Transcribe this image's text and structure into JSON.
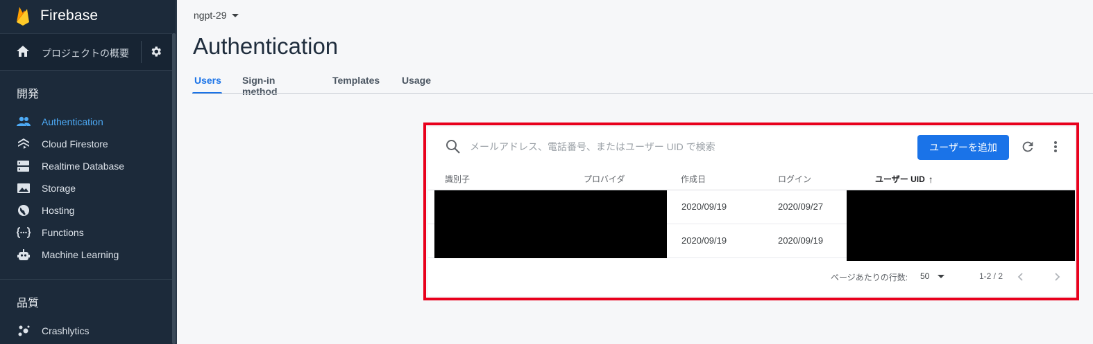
{
  "brand": {
    "name": "Firebase"
  },
  "sidebar": {
    "overview_label": "プロジェクトの概要",
    "section_dev": "開発",
    "section_quality": "品質",
    "items": [
      {
        "label": "Authentication",
        "icon": "people-icon",
        "active": true
      },
      {
        "label": "Cloud Firestore",
        "icon": "firestore-icon"
      },
      {
        "label": "Realtime Database",
        "icon": "database-icon"
      },
      {
        "label": "Storage",
        "icon": "image-icon"
      },
      {
        "label": "Hosting",
        "icon": "globe-icon"
      },
      {
        "label": "Functions",
        "icon": "functions-icon"
      },
      {
        "label": "Machine Learning",
        "icon": "robot-icon"
      }
    ],
    "quality_items": [
      {
        "label": "Crashlytics",
        "icon": "crashlytics-icon"
      }
    ]
  },
  "header": {
    "project": "ngpt-29",
    "title": "Authentication",
    "tabs": [
      {
        "label": "Users",
        "active": true
      },
      {
        "label": "Sign-in method"
      },
      {
        "label": "Templates"
      },
      {
        "label": "Usage"
      }
    ]
  },
  "users": {
    "search_placeholder": "メールアドレス、電話番号、またはユーザー UID で検索",
    "add_button": "ユーザーを追加",
    "columns": [
      "識別子",
      "プロバイダ",
      "作成日",
      "ログイン",
      "ユーザー UID"
    ],
    "sort_indicator": "↑",
    "rows": [
      {
        "created": "2020/09/19",
        "login": "2020/09/27"
      },
      {
        "created": "2020/09/19",
        "login": "2020/09/19"
      }
    ],
    "rows_per_page_label": "ページあたりの行数:",
    "rows_per_page": "50",
    "range": "1-2 / 2"
  },
  "colors": {
    "sidebar_bg": "#1c2a3a",
    "accent": "#1a73e8",
    "highlight": "#e8001c"
  }
}
